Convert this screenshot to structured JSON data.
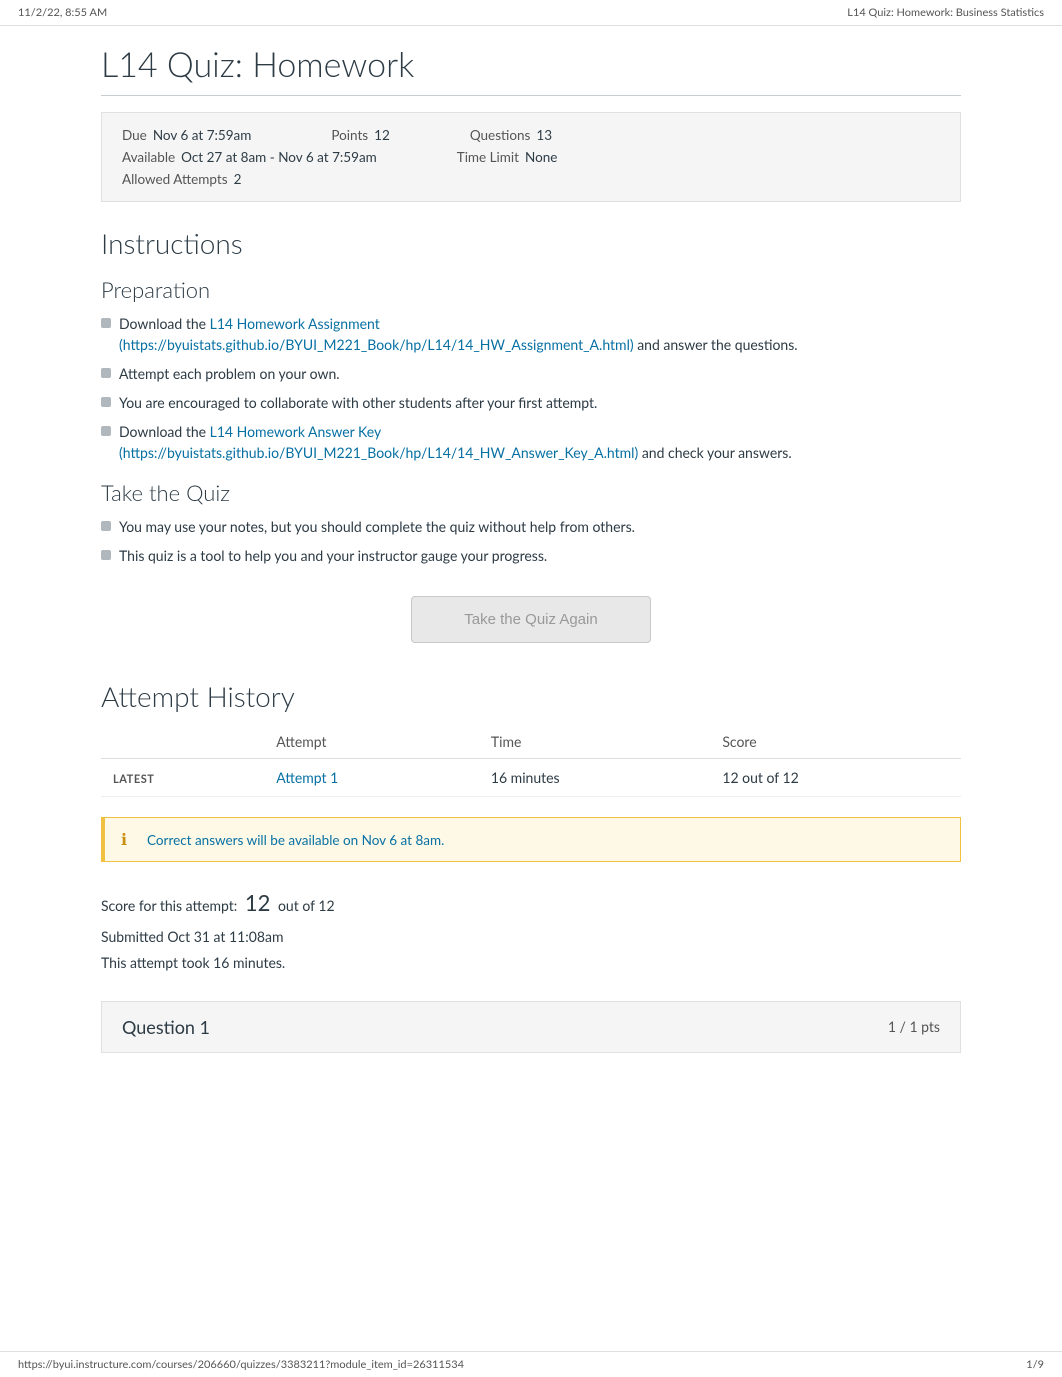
{
  "topbar": {
    "timestamp": "11/2/22, 8:55 AM",
    "page_title": "L14 Quiz: Homework: Business Statistics"
  },
  "quiz": {
    "title": "L14 Quiz: Homework",
    "meta": {
      "due_label": "Due",
      "due_value": "Nov 6 at 7:59am",
      "points_label": "Points",
      "points_value": "12",
      "questions_label": "Questions",
      "questions_value": "13",
      "available_label": "Available",
      "available_value": "Oct 27 at 8am - Nov 6 at 7:59am",
      "time_limit_label": "Time Limit",
      "time_limit_value": "None",
      "allowed_attempts_label": "Allowed Attempts",
      "allowed_attempts_value": "2"
    }
  },
  "instructions": {
    "heading": "Instructions",
    "preparation": {
      "heading": "Preparation",
      "items": [
        {
          "pre_text": "Download the",
          "link_text": "L14 Homework Assignment (https://byuistats.github.io/BYUI_M221_Book/hp/L14/14_HW_Assignment_A.html)",
          "link_url": "https://byuistats.github.io/BYUI_M221_Book/hp/L14/14_HW_Assignment_A.html",
          "post_text": "and answer the questions."
        },
        {
          "pre_text": "Attempt each problem on your own.",
          "link_text": "",
          "link_url": "",
          "post_text": ""
        },
        {
          "pre_text": "You are encouraged to collaborate with other students after your first attempt.",
          "link_text": "",
          "link_url": "",
          "post_text": ""
        },
        {
          "pre_text": "Download the",
          "link_text": "L14 Homework Answer Key (https://byuistats.github.io/BYUI_M221_Book/hp/L14/14_HW_Answer_Key_A.html)",
          "link_url": "https://byuistats.github.io/BYUI_M221_Book/hp/L14/14_HW_Answer_Key_A.html",
          "post_text": "and check your answers."
        }
      ]
    },
    "take_the_quiz": {
      "heading": "Take the Quiz",
      "items": [
        "You may use your notes, but you should complete the quiz without help from others.",
        "This quiz is a tool to help you and your instructor gauge your progress."
      ]
    }
  },
  "take_quiz_button": "Take the Quiz Again",
  "attempt_history": {
    "heading": "Attempt History",
    "columns": [
      "",
      "Attempt",
      "Time",
      "Score"
    ],
    "rows": [
      {
        "label": "LATEST",
        "attempt_text": "Attempt 1",
        "attempt_url": "#",
        "time": "16 minutes",
        "score": "12 out of 12"
      }
    ]
  },
  "info_box": {
    "icon": "ℹ",
    "text": "Correct answers will be available on Nov 6 at 8am."
  },
  "score_section": {
    "score_for_attempt_label": "Score for this attempt:",
    "score_value": "12",
    "score_out_of": "out of 12",
    "submitted_label": "Submitted Oct 31 at 11:08am",
    "took_label": "This attempt took 16 minutes."
  },
  "question1": {
    "label": "Question 1",
    "pts": "1 / 1 pts"
  },
  "bottom_bar": {
    "url": "https://byui.instructure.com/courses/206660/quizzes/3383211?module_item_id=26311534",
    "pagination": "1/9"
  }
}
